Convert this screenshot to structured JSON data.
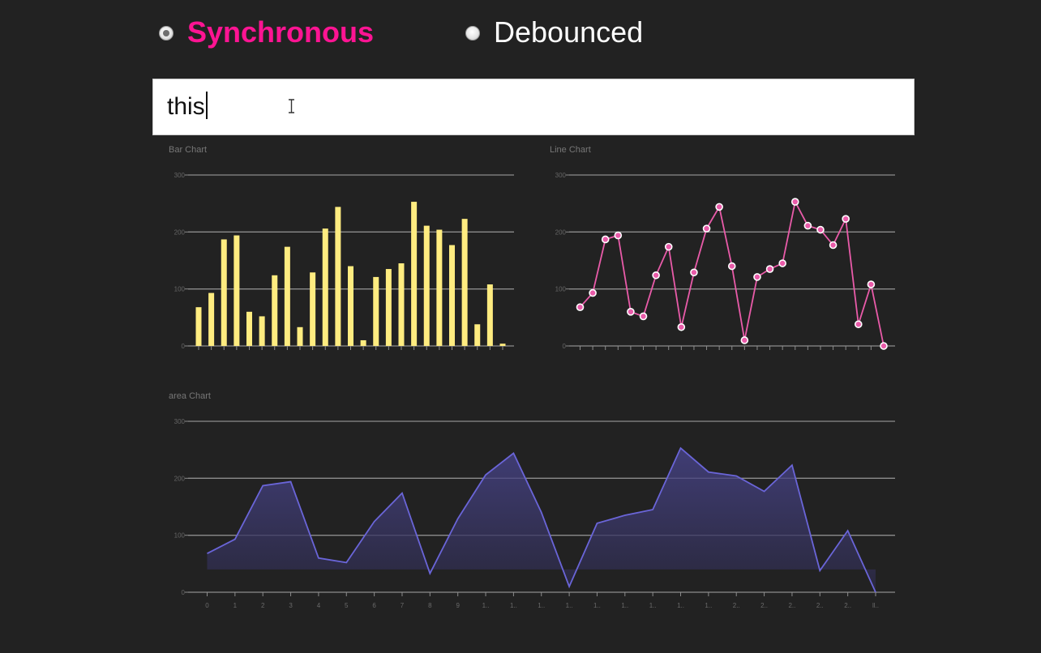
{
  "mode_selector": {
    "options": [
      {
        "label": "Synchronous",
        "selected": true,
        "color": "#ff1493"
      },
      {
        "label": "Debounced",
        "selected": false,
        "color": "#ffffff"
      }
    ]
  },
  "search": {
    "value": "this"
  },
  "chart_data": [
    {
      "type": "bar",
      "title": "Bar Chart",
      "ylim": [
        0,
        300
      ],
      "yticks": [
        0,
        100,
        200,
        300
      ],
      "grid": true,
      "color": "#ffec80",
      "x": [
        0,
        1,
        2,
        3,
        4,
        5,
        6,
        7,
        8,
        9,
        10,
        11,
        12,
        13,
        14,
        15,
        16,
        17,
        18,
        19,
        20,
        21,
        22,
        23,
        24
      ],
      "values": [
        68,
        93,
        187,
        194,
        60,
        52,
        124,
        174,
        33,
        129,
        206,
        244,
        140,
        10,
        121,
        135,
        145,
        253,
        211,
        204,
        177,
        223,
        38,
        108,
        4
      ]
    },
    {
      "type": "line",
      "title": "Line Chart",
      "ylim": [
        0,
        300
      ],
      "yticks": [
        0,
        100,
        200,
        300
      ],
      "grid": true,
      "color": "#e95ba9",
      "x": [
        0,
        1,
        2,
        3,
        4,
        5,
        6,
        7,
        8,
        9,
        10,
        11,
        12,
        13,
        14,
        15,
        16,
        17,
        18,
        19,
        20,
        21,
        22,
        23,
        24
      ],
      "values": [
        68,
        93,
        187,
        194,
        60,
        52,
        124,
        174,
        33,
        129,
        206,
        244,
        140,
        10,
        121,
        135,
        145,
        253,
        211,
        204,
        177,
        223,
        38,
        108,
        0
      ]
    },
    {
      "type": "area",
      "title": "area Chart",
      "ylim": [
        0,
        300
      ],
      "yticks": [
        0,
        100,
        200,
        300
      ],
      "grid": true,
      "color": "#6a65d8",
      "x": [
        0,
        1,
        2,
        3,
        4,
        5,
        6,
        7,
        8,
        9,
        10,
        11,
        12,
        13,
        14,
        15,
        16,
        17,
        18,
        19,
        20,
        21,
        22,
        23,
        24
      ],
      "x_tick_labels": [
        "0",
        "1",
        "2",
        "3",
        "4",
        "5",
        "6",
        "7",
        "8",
        "9",
        "1..",
        "1..",
        "1..",
        "1..",
        "1..",
        "1..",
        "1..",
        "1..",
        "1..",
        "2..",
        "2..",
        "2..",
        "2..",
        "2..",
        "ll.."
      ],
      "values": [
        68,
        93,
        187,
        194,
        60,
        52,
        124,
        174,
        33,
        129,
        206,
        244,
        140,
        10,
        121,
        135,
        145,
        253,
        211,
        204,
        177,
        223,
        38,
        108,
        0
      ]
    }
  ]
}
